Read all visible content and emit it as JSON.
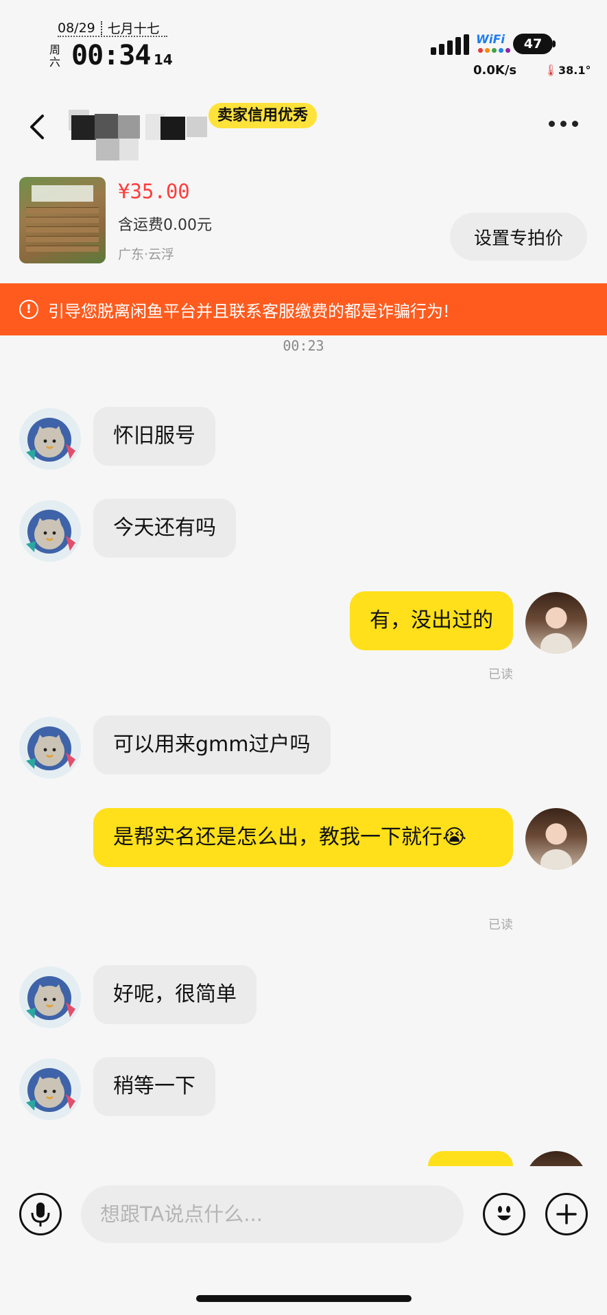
{
  "status_bar": {
    "date": "08/29",
    "lunar_date": "七月十七",
    "weekday": "周六",
    "time": "00:34",
    "seconds": "14",
    "wifi_label": "WiFi",
    "battery": "47",
    "net_speed": "0.0K/s",
    "temperature": "38.1°"
  },
  "header": {
    "credit_badge": "卖家信用优秀"
  },
  "product": {
    "price": "¥35.00",
    "shipping": "含运费0.00元",
    "location": "广东·云浮",
    "special_price_button": "设置专拍价"
  },
  "warning": {
    "icon_glyph": "!",
    "text": "引导您脱离闲鱼平台并且联系客服缴费的都是诈骗行为!"
  },
  "call_time": "00:23",
  "messages": [
    {
      "from": "buyer",
      "text": "怀旧服号"
    },
    {
      "from": "buyer",
      "text": "今天还有吗"
    },
    {
      "from": "seller",
      "text": "有，没出过的",
      "status": "已读"
    },
    {
      "from": "buyer",
      "text": "可以用来gmm过户吗"
    },
    {
      "from": "seller",
      "text": "是帮实名还是怎么出，教我一下就行😭",
      "status": "已读"
    },
    {
      "from": "buyer",
      "text": "好呢，很简单"
    },
    {
      "from": "buyer",
      "text": "稍等一下"
    }
  ],
  "input": {
    "placeholder": "想跟TA说点什么..."
  },
  "colors": {
    "accent_yellow": "#ffe01a",
    "warning_orange": "#ff5b1e",
    "price_red": "#ff3d3d"
  },
  "icons": [
    "back-arrow-icon",
    "more-dots-icon",
    "warning-circle-icon",
    "microphone-icon",
    "emoji-icon",
    "plus-icon"
  ]
}
